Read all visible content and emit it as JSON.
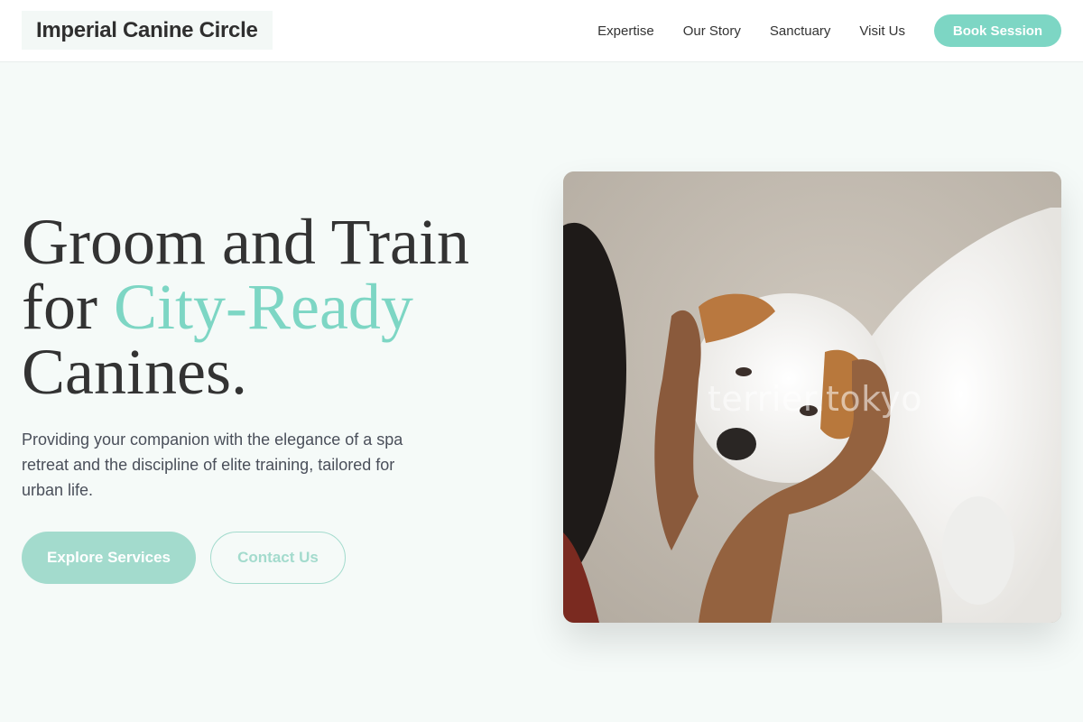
{
  "header": {
    "brand": "Imperial Canine Circle",
    "nav": [
      "Expertise",
      "Our Story",
      "Sanctuary",
      "Visit Us"
    ],
    "cta": "Book Session"
  },
  "hero": {
    "title_line1": "Groom and Train",
    "title_for": "for ",
    "title_accent": "City-Ready",
    "title_line3": "Canines.",
    "description": "Providing your companion with the elegance of a spa retreat and the discipline of elite training, tailored for urban life.",
    "primary_button": "Explore Services",
    "secondary_button": "Contact Us",
    "image_watermark": "terrier.tokyo"
  },
  "colors": {
    "accent": "#7dd6c4",
    "button_soft": "#a3dbcd",
    "background": "#f5faf8"
  }
}
